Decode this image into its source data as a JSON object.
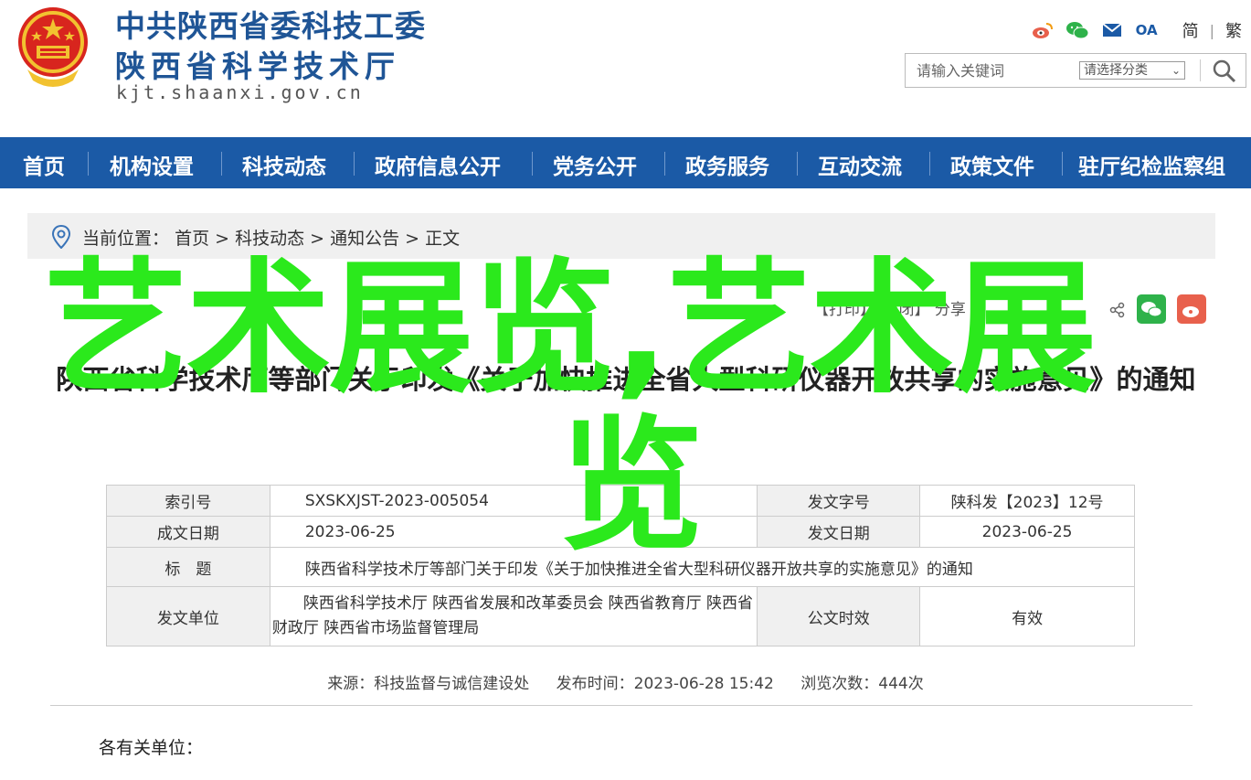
{
  "header": {
    "org_line1": "中共陕西省委科技工委",
    "org_line2": "陕西省科学技术厅",
    "domain": "kjt.shaanxi.gov.cn",
    "icons": [
      "weibo-icon",
      "wechat-icon",
      "mail-icon",
      "oa-icon"
    ],
    "oa_label": "OA",
    "lang_simplified": "简",
    "lang_separator": "|",
    "lang_traditional": "繁"
  },
  "search": {
    "placeholder": "请输入关键词",
    "category_selected": "请选择分类"
  },
  "nav": {
    "items": [
      "首页",
      "机构设置",
      "科技动态",
      "政府信息公开",
      "党务公开",
      "政务服务",
      "互动交流",
      "政策文件",
      "驻厅纪检监察组"
    ]
  },
  "breadcrumb": {
    "prefix": "当前位置：",
    "items": [
      "首页",
      "科技动态",
      "通知公告",
      "正文"
    ],
    "separator": " > "
  },
  "tools": {
    "text": "【打印】【关闭】 分享"
  },
  "article": {
    "title": "陕西省科学技术厅等部门关于印发《关于加快推进全省大型科研仪器开放共享的实施意见》的通知",
    "info": {
      "index_label": "索引号",
      "index_value": "SXSKXJST-2023-005054",
      "doc_no_label": "发文字号",
      "doc_no_value": "陕科发【2023】12号",
      "written_label": "成文日期",
      "written_value": "2023-06-25",
      "issued_label": "发文日期",
      "issued_value": "2023-06-25",
      "subject_label": "标　题",
      "subject_value": "陕西省科学技术厅等部门关于印发《关于加快推进全省大型科研仪器开放共享的实施意见》的通知",
      "issuer_label": "发文单位",
      "issuer_value": "　　陕西省科学技术厅 陕西省发展和改革委员会 陕西省教育厅 陕西省财政厅 陕西省市场监督管理局",
      "validity_label": "公文时效",
      "validity_value": "有效"
    },
    "meta": {
      "source": "来源：科技监督与诚信建设处",
      "published": "发布时间：2023-06-28 15:42",
      "views": "浏览次数：444次"
    },
    "salutation": "各有关单位："
  },
  "watermark": {
    "line1": "艺术展览,艺术展",
    "line2": "览"
  },
  "colors": {
    "nav_bg": "#1b5aa6",
    "brand_blue": "#1f5596",
    "watermark_green": "#2be91c",
    "wechat_green": "#2eb24a",
    "weibo_red": "#e8604c"
  }
}
